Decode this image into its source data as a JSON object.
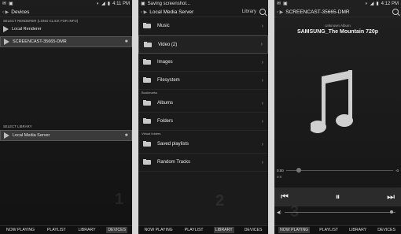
{
  "panel1": {
    "status": {
      "time": "4:11 PM"
    },
    "title": "Devices",
    "renderer_section": "SELECT RENDERER (LONG-CLICK FOR INFO)",
    "renderers": [
      "Local Renderer",
      "SCREENCAST-35665-DMR"
    ],
    "library_section": "SELECT LIBRARY",
    "library": "Local Media Server",
    "marker": "1",
    "tabs": [
      "NOW PLAYING",
      "PLAYLIST",
      "LIBRARY",
      "DEVICES"
    ],
    "active_tab": "DEVICES"
  },
  "panel2": {
    "status": {
      "notice": "Saving screenshot..."
    },
    "title": "Local Media Server",
    "title_right": "Library",
    "items": [
      {
        "label": "Music"
      },
      {
        "label": "Video (2)"
      },
      {
        "label": "Images"
      },
      {
        "label": "Filesystem"
      }
    ],
    "bookmarks_label": "Bookmarks",
    "bookmarks": [
      {
        "label": "Albums"
      },
      {
        "label": "Folders"
      }
    ],
    "virtual_label": "Virtual folders",
    "virtual": [
      {
        "label": "Saved playlists"
      },
      {
        "label": "Random Tracks"
      }
    ],
    "marker": "2",
    "tabs": [
      "NOW PLAYING",
      "PLAYLIST",
      "LIBRARY",
      "DEVICES"
    ],
    "active_tab": "LIBRARY"
  },
  "panel3": {
    "status": {
      "time": "4:12 PM"
    },
    "title": "SCREENCAST-35665-DMR",
    "subtitle": "Unknown Album",
    "track": "SAMSUNG_The Mountain 720p",
    "elapsed": "0:00",
    "elapsed_sub": "0:0",
    "remaining": "-0",
    "marker": "3",
    "tabs": [
      "NOW PLAYING",
      "PLAYLIST",
      "LIBRARY",
      "DEVICES"
    ],
    "active_tab": "NOW PLAYING"
  }
}
